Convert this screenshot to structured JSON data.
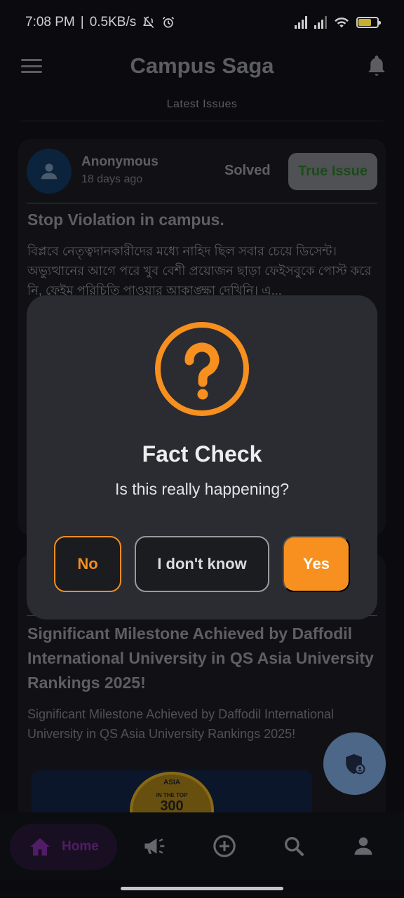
{
  "status_bar": {
    "time": "7:08 PM",
    "network_speed": "0.5KB/s",
    "battery_level": 0.7,
    "battery_text": "71"
  },
  "app_bar": {
    "title": "Campus Saga",
    "subtitle": "Latest Issues"
  },
  "feed": {
    "post1": {
      "author": "Anonymous",
      "time_ago": "18 days ago",
      "status": "Solved",
      "action_label": "True Issue",
      "title": "Stop Violation in campus.",
      "body": "বিপ্লবে নেতৃত্বদানকারীদের মধ্যে নাহিদ ছিল সবার চেয়ে ডিসেন্ট। অভ্যুত্থানের আগে পরে খুব বেশী প্রয়োজন ছাড়া ফেইসবুকে পোস্ট করে নি, ফেইম পরিচিতি পাওয়ার আকাঙ্ক্ষা দেখিনি। এ..."
    },
    "post2": {
      "title": "Significant Milestone Achieved by Daffodil International University in QS Asia University Rankings 2025!",
      "body": "Significant Milestone Achieved by Daffodil International University in QS Asia University Rankings 2025!",
      "image_badge": {
        "line1": "ASIA",
        "line2": "IN THE TOP",
        "line3": "300"
      }
    }
  },
  "dialog": {
    "title": "Fact Check",
    "message": "Is this really happening?",
    "buttons": {
      "no": "No",
      "idk": "I don't know",
      "yes": "Yes"
    },
    "accent_color": "#f7901e"
  },
  "bottom_nav": {
    "home_label": "Home",
    "items": [
      "home-icon",
      "announcement-icon",
      "add-circle-icon",
      "search-icon",
      "person-icon"
    ]
  },
  "colors": {
    "background": "#0d0e12",
    "dialog": "#2b2c31",
    "accent": "#f7901e",
    "fab": "#5b7aa0"
  }
}
